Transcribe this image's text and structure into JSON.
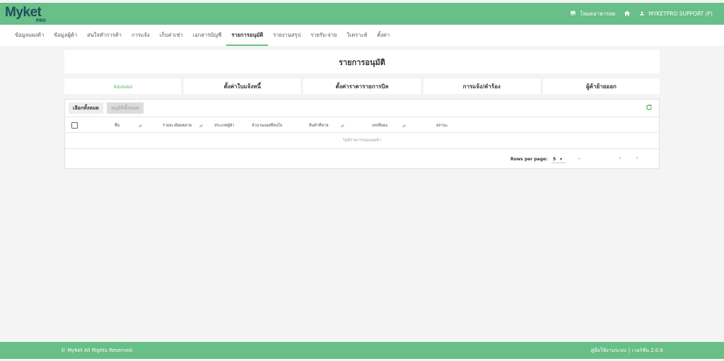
{
  "header": {
    "logo_text": "Myket",
    "logo_sub": "PRO",
    "restaurant_mode": "โหมดอาหารสด",
    "user_name": "MYKETPRO SUPPORT (P)"
  },
  "nav": {
    "items": [
      {
        "label": "ข้อมูลแผงค้า"
      },
      {
        "label": "ข้อมูลผู้ค้า"
      },
      {
        "label": "สนใจทำการค้า"
      },
      {
        "label": "การแจ้ง"
      },
      {
        "label": "เก็บค่าเช่า"
      },
      {
        "label": "เอกสารบัญชี"
      },
      {
        "label": "รายการอนุมัติ"
      },
      {
        "label": "รายงานสรุป"
      },
      {
        "label": "รายรับ-จ่าย"
      },
      {
        "label": "วิเคราะห์"
      },
      {
        "label": "ตั้งค่า"
      }
    ],
    "active_index": 6
  },
  "page_title": "รายการอนุมัติ",
  "tabs": [
    {
      "label": "จองแผง"
    },
    {
      "label": "ตั้งค่าใบแจ้งหนี้"
    },
    {
      "label": "ตั้งค่าราคารายการบิล"
    },
    {
      "label": "การแจ้ง/คำร้อง"
    },
    {
      "label": "ผู้ค้าย้ายออก"
    }
  ],
  "active_tab": 0,
  "table": {
    "select_all_label": "เลือกทั้งหมด",
    "approve_all_label": "อนุมัติทั้งหมด",
    "columns": [
      {
        "label": "ชื่อ"
      },
      {
        "label": "รายละเอียดตลาด"
      },
      {
        "label": "ประเภทผู้ค้า"
      },
      {
        "label": "จำนวนแผงที่สนใจ"
      },
      {
        "label": "สินค้าที่ขาย"
      },
      {
        "label": "เลขที่แผง"
      },
      {
        "label": "สถานะ"
      }
    ],
    "empty_text": "ไม่มีรายการจองแผงค้า",
    "rows_per_page_label": "Rows per page:",
    "rows_per_page_value": "5",
    "page_range": "–"
  },
  "footer": {
    "copyright": "© MyKet All Rights Reserved.",
    "manual": "คู่มือใช้งานระบบ",
    "separator": "|",
    "version": "เวอร์ชั่น 2.0.6"
  },
  "colors": {
    "brand_green": "#68bf87",
    "active_tab_text": "#5cb86e",
    "logo_navy": "#1f4e5c"
  }
}
